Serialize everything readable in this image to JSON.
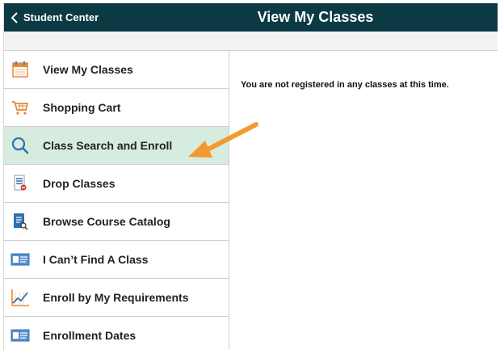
{
  "header": {
    "back_label": "Student Center",
    "title": "View My Classes",
    "background": "#0b3a44"
  },
  "sidebar": {
    "items": [
      {
        "label": "View My Classes",
        "icon": "calendar-icon"
      },
      {
        "label": "Shopping Cart",
        "icon": "shopping-cart-icon"
      },
      {
        "label": "Class Search and Enroll",
        "icon": "search-icon",
        "active": true
      },
      {
        "label": "Drop Classes",
        "icon": "drop-list-icon"
      },
      {
        "label": "Browse Course Catalog",
        "icon": "catalog-icon"
      },
      {
        "label": "I Can’t Find A Class",
        "icon": "id-card-icon"
      },
      {
        "label": "Enroll by My Requirements",
        "icon": "trend-chart-icon"
      },
      {
        "label": "Enrollment Dates",
        "icon": "id-card-icon"
      }
    ],
    "active_color": "#d6ecde"
  },
  "main": {
    "message": "You are not registered in any classes at this time."
  },
  "annotation": {
    "arrow_color": "#f29a2e"
  }
}
